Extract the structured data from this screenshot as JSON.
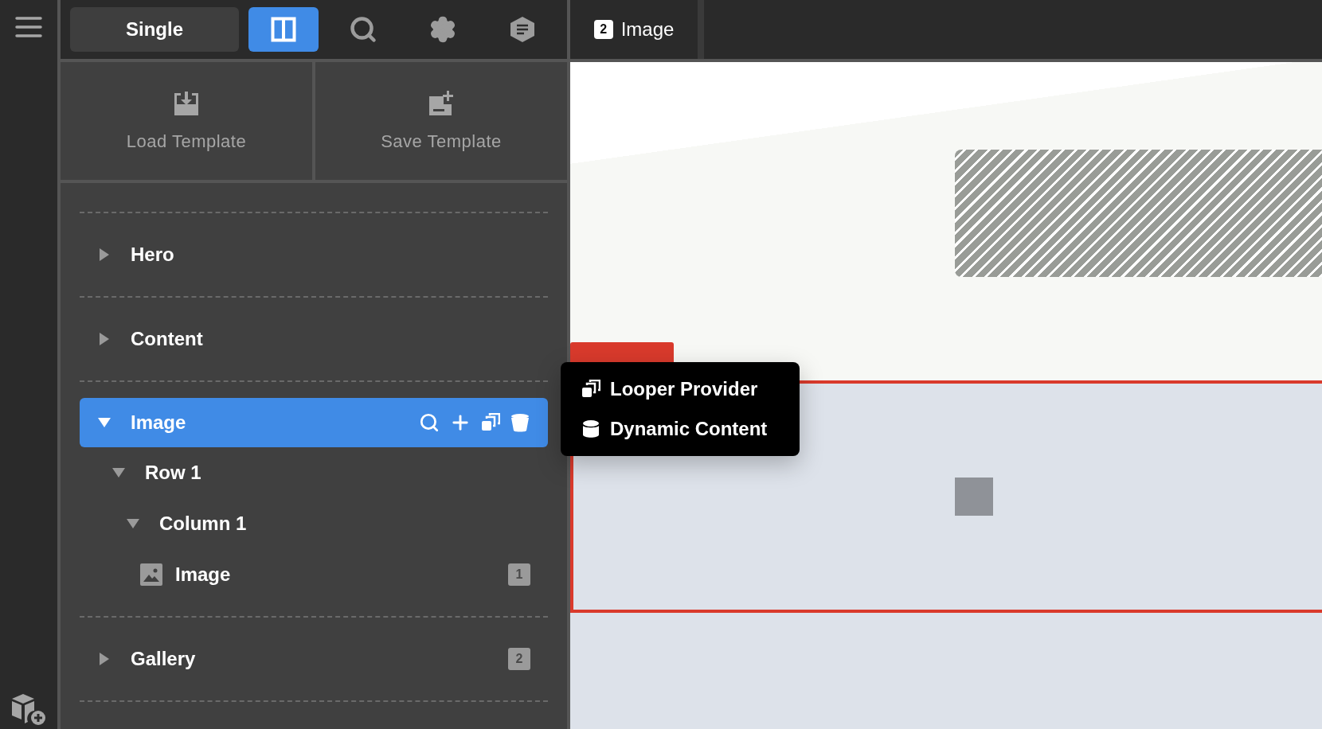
{
  "toolbar": {
    "mode_button": "Single",
    "layout_toggle": {
      "on": true
    }
  },
  "tab": {
    "number": "2",
    "label": "Image"
  },
  "templates": [
    "Load Template",
    "Save Template"
  ],
  "tree": [
    {
      "label": "Hero",
      "kind": "section",
      "expanded": false,
      "selected": false
    },
    {
      "label": "Content",
      "kind": "section",
      "expanded": false,
      "selected": false
    },
    {
      "label": "Image",
      "kind": "section",
      "expanded": true,
      "selected": true,
      "children": [
        {
          "label": "Row 1",
          "kind": "group",
          "expanded": true,
          "selected": false,
          "children": [
            {
              "label": "Column 1",
              "kind": "group",
              "expanded": true,
              "selected": false,
              "children": [
                {
                  "label": "Image",
                  "kind": "element",
                  "selected": false,
                  "badge": "1"
                }
              ]
            }
          ]
        }
      ]
    },
    {
      "label": "Gallery",
      "kind": "section",
      "expanded": false,
      "selected": false,
      "badge": "2"
    }
  ],
  "popover": [
    {
      "kind": "looper",
      "label": "Looper Provider"
    },
    {
      "kind": "dynamic",
      "label": "Dynamic Content"
    }
  ]
}
